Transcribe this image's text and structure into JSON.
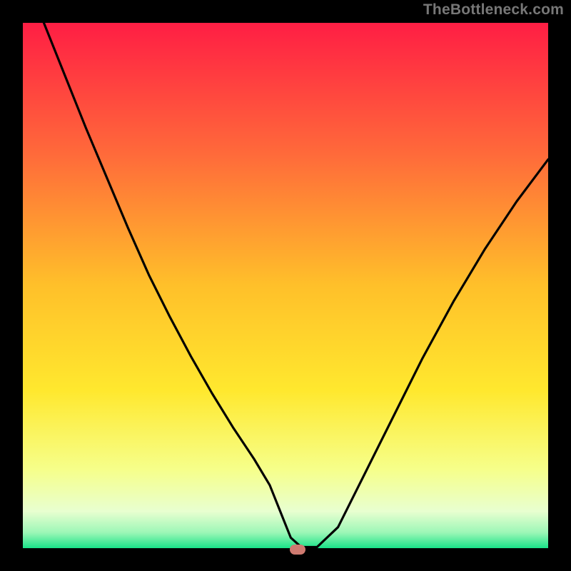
{
  "watermark": "TheBottleneck.com",
  "chart_data": {
    "type": "line",
    "title": "",
    "xlabel": "",
    "ylabel": "",
    "xlim": [
      0,
      100
    ],
    "ylim": [
      0,
      100
    ],
    "background_gradient": {
      "stops": [
        {
          "pct": 0,
          "color": "#ff1e44"
        },
        {
          "pct": 25,
          "color": "#ff6a3a"
        },
        {
          "pct": 50,
          "color": "#ffc02a"
        },
        {
          "pct": 70,
          "color": "#ffe82e"
        },
        {
          "pct": 85,
          "color": "#f6ff8a"
        },
        {
          "pct": 93,
          "color": "#e8ffd0"
        },
        {
          "pct": 97,
          "color": "#9df7b7"
        },
        {
          "pct": 100,
          "color": "#19e388"
        }
      ]
    },
    "series": [
      {
        "name": "bottleneck-curve",
        "color": "#000000",
        "x": [
          4,
          8,
          12,
          16,
          20,
          24,
          28,
          32,
          36,
          40,
          44,
          47,
          49,
          51,
          53,
          56,
          60,
          64,
          70,
          76,
          82,
          88,
          94,
          100
        ],
        "y": [
          100,
          90,
          80,
          70.5,
          61,
          52,
          44,
          36.5,
          29.5,
          23,
          17,
          12,
          7,
          2,
          0.2,
          0.2,
          4,
          12,
          24,
          36,
          47,
          57,
          66,
          74
        ]
      }
    ],
    "marker": {
      "x": 52,
      "y": 0.3,
      "color": "#cf7a70"
    }
  }
}
